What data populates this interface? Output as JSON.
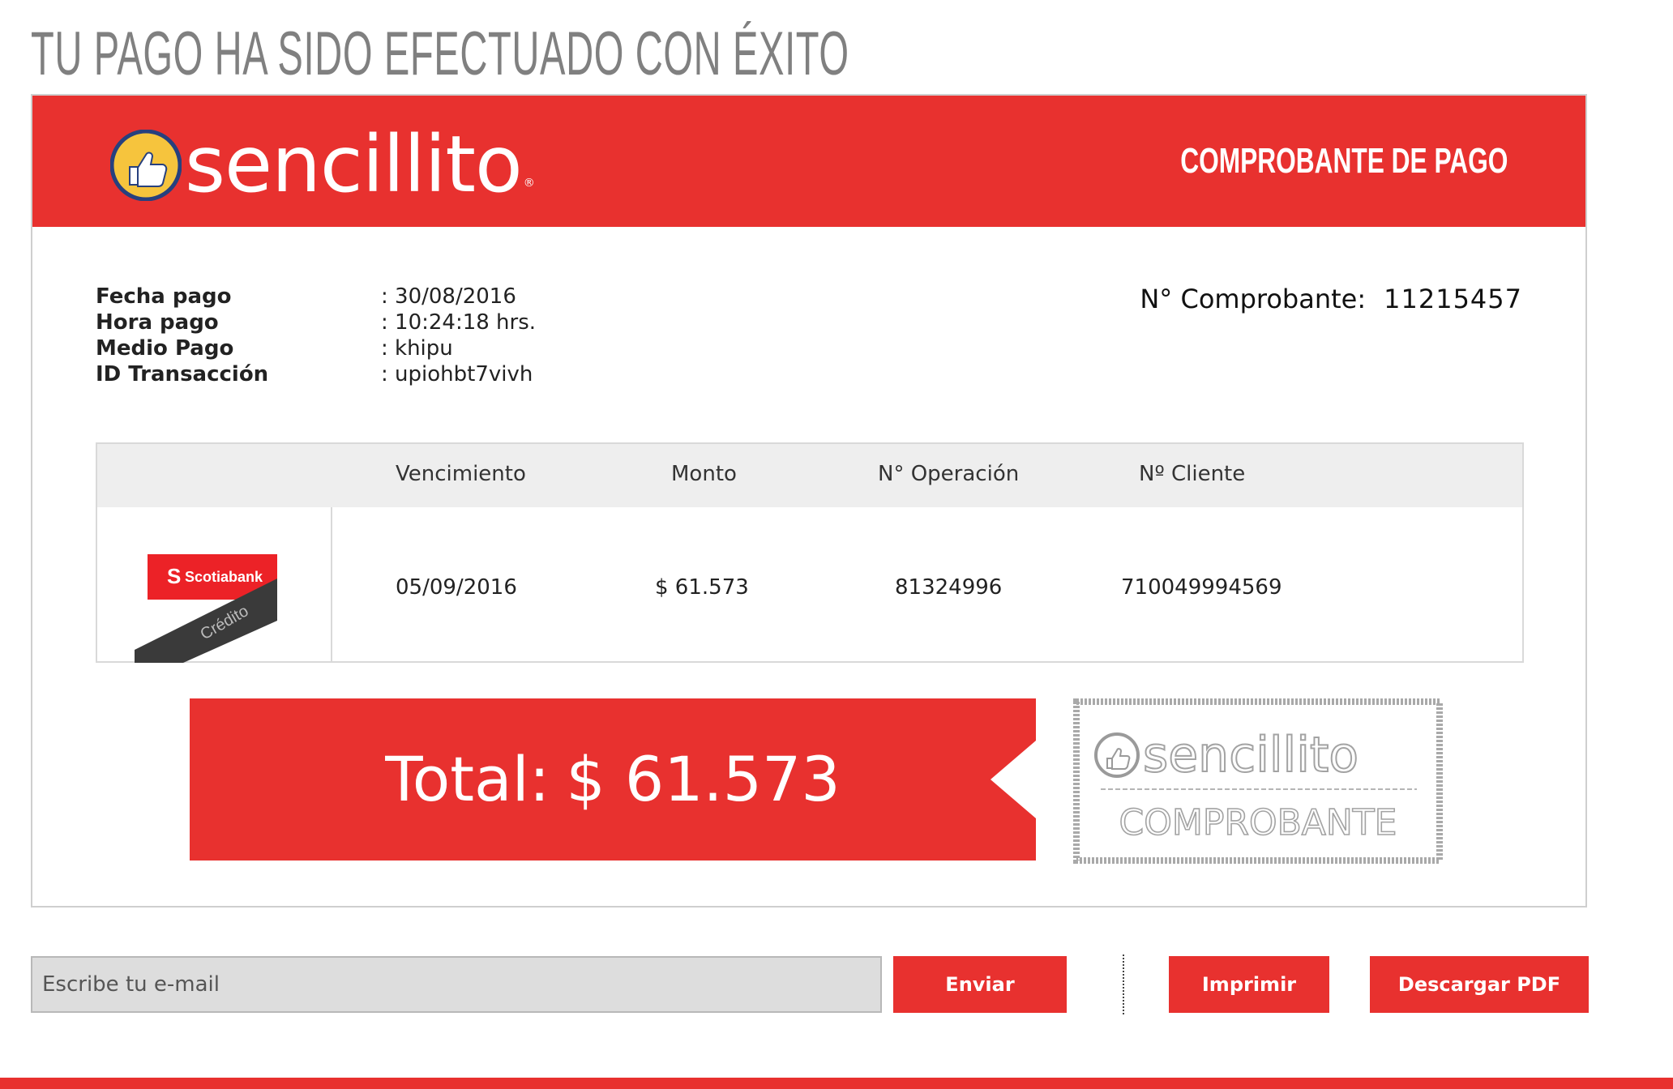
{
  "page": {
    "title": "TU PAGO HA SIDO EFECTUADO CON ÉXITO"
  },
  "header": {
    "brand": "sencillito",
    "label": "COMPROBANTE DE PAGO",
    "accent_color": "#e8312f"
  },
  "details": {
    "rows": [
      {
        "label": "Fecha pago",
        "value": ": 30/08/2016"
      },
      {
        "label": "Hora pago",
        "value": ": 10:24:18 hrs."
      },
      {
        "label": "Medio Pago",
        "value": ": khipu"
      },
      {
        "label": "ID Transacción",
        "value": ": upiohbt7vivh"
      }
    ],
    "receipt_label": "N° Comprobante:",
    "receipt_number": "11215457"
  },
  "table": {
    "headers": [
      "Vencimiento",
      "Monto",
      "N° Operación",
      "Nº Cliente"
    ],
    "row": {
      "bank": "Scotiabank",
      "bank_tag": "Crédito",
      "vencimiento": "05/09/2016",
      "monto": "$ 61.573",
      "operacion": "81324996",
      "cliente": "710049994569"
    }
  },
  "total": {
    "label": "Total:",
    "value": "$ 61.573"
  },
  "stamp": {
    "brand": "sencillito",
    "text": "COMPROBANTE"
  },
  "actions": {
    "email_placeholder": "Escribe tu e-mail",
    "send": "Enviar",
    "print": "Imprimir",
    "download": "Descargar PDF"
  }
}
